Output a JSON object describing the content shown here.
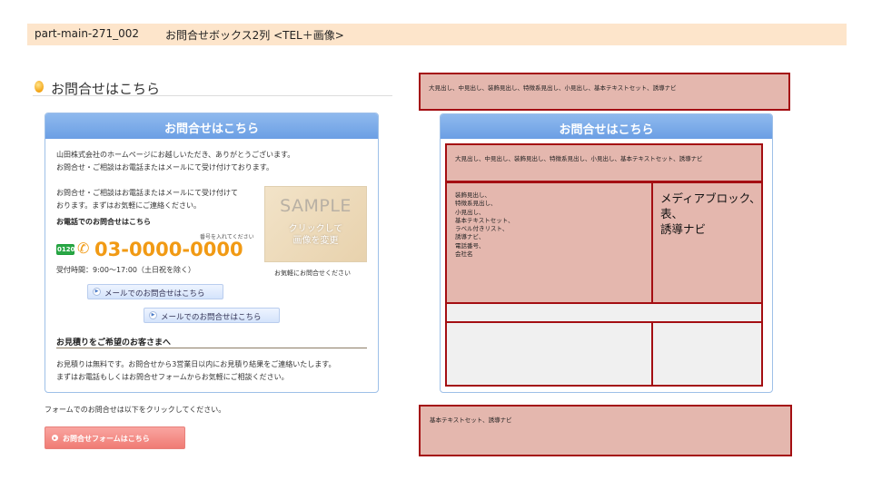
{
  "header": {
    "id": "part-main-271_002",
    "title": "お問合せボックス2列 <TEL＋画像>"
  },
  "section": {
    "heading": "お問合せはこちら"
  },
  "box": {
    "title": "お問合せはこちら",
    "intro": [
      "山田株式会社のホームページにお越しいただき、ありがとうございます。",
      "お問合せ・ご相談はお電話またはメールにて受け付けております。"
    ],
    "body": [
      "お問合せ・ご相談はお電話またはメールにて受け付けて",
      "おります。まずはお気軽にご連絡ください。"
    ],
    "phone_heading": "お電話でのお問合せはこちら",
    "freedial_label": "0120",
    "phone_note": "番号を入れてください",
    "phone_number": "03-0000-0000",
    "hours": "受付時間：9:00〜17:00（土日祝を除く）",
    "mail_button_1": "メールでのお問合せはこちら",
    "mail_button_2": "メールでのお問合せはこちら",
    "image": {
      "big": "SAMPLE",
      "line1": "クリックして",
      "line2": "画像を変更",
      "caption": "お気軽にお問合せください"
    },
    "estimate_heading": "お見積りをご希望のお客さまへ",
    "estimate_text": [
      "お見積りは無料です。お問合せから3営業日以内にお見積り結果をご連絡いたします。",
      "まずはお電話もしくはお問合せフォームからお気軽にご相談ください。"
    ]
  },
  "form": {
    "note": "フォームでのお問合せは以下をクリックしてください。",
    "button": "お問合せフォームはこちら"
  },
  "diagram": {
    "top_label": "大見出し、中見出し、装飾見出し、特徴系見出し、小見出し、基本テキストセット、誘導ナビ",
    "title": "お問合せはこちら",
    "inner_label": "大見出し、中見出し、装飾見出し、特徴系見出し、小見出し、基本テキストセット、誘導ナビ",
    "list": [
      "装飾見出し、",
      "特徴系見出し、",
      "小見出し、",
      "基本テキストセット、",
      "ラベル付きリスト、",
      "誘導ナビ、",
      "電話番号、",
      "会社名"
    ],
    "media": [
      "メディアブロック、",
      "表、",
      "誘導ナビ"
    ],
    "bottom_label": "基本テキストセット、誘導ナビ"
  },
  "colors": {
    "header_bg": "#fde5cb",
    "box_head": "#6b9fe4",
    "accent_orange": "#f19a14",
    "form_button": "#f07b74",
    "diagram_fill": "#e4b7ae",
    "diagram_border": "#a40e12"
  },
  "icons": {
    "heading": "bullet-dot-icon",
    "freedial": "freedial-icon",
    "phone": "phone-icon",
    "button": "arrow-circle-icon"
  }
}
